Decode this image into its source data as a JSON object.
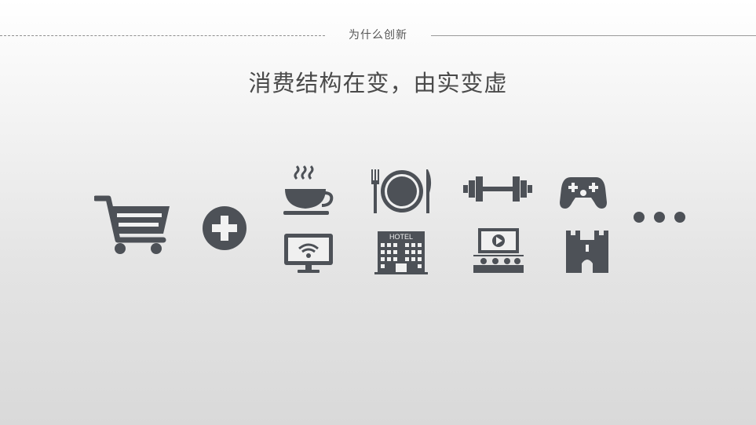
{
  "header": {
    "section_label": "为什么创新",
    "headline": "消费结构在变，由实变虚",
    "icon_color": "#4d5157"
  },
  "icons": [
    "shopping-cart-icon",
    "plus-circle-icon",
    "coffee-cup-icon",
    "dinner-plate-icon",
    "dumbbell-icon",
    "game-controller-icon",
    "wifi-monitor-icon",
    "hotel-icon",
    "cinema-icon",
    "castle-icon",
    "ellipsis-icon"
  ],
  "hotel_sign": "HOTEL"
}
